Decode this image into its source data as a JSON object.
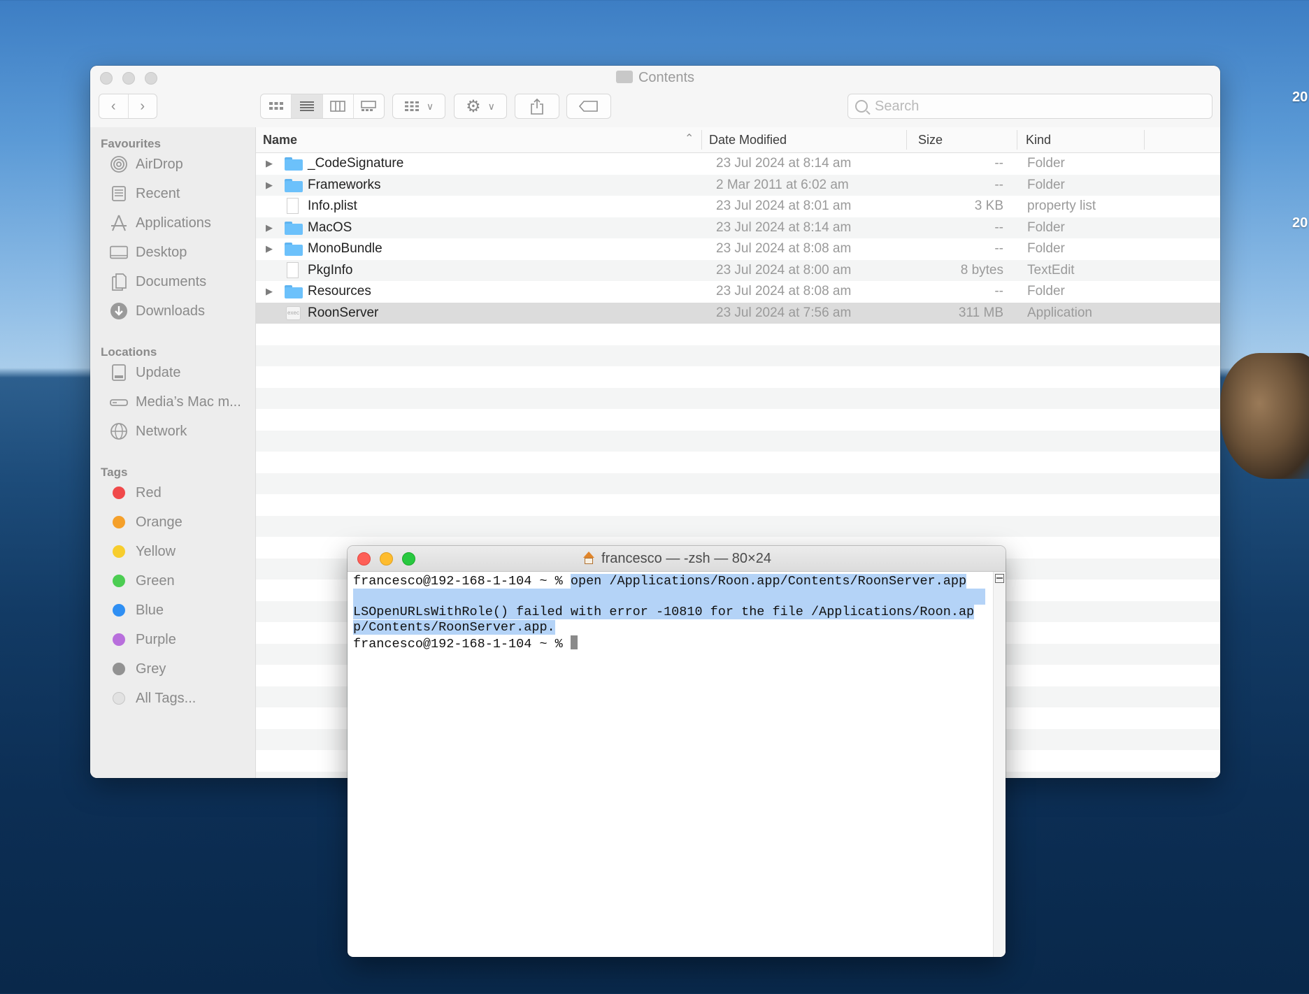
{
  "desktop": {
    "labels": [
      "20",
      "20"
    ]
  },
  "finder": {
    "title": "Contents",
    "search_placeholder": "Search",
    "sidebar": {
      "favourites_heading": "Favourites",
      "favourites": [
        {
          "label": "AirDrop",
          "icon": "airdrop-icon"
        },
        {
          "label": "Recent",
          "icon": "recent-icon"
        },
        {
          "label": "Applications",
          "icon": "applications-icon"
        },
        {
          "label": "Desktop",
          "icon": "desktop-icon"
        },
        {
          "label": "Documents",
          "icon": "documents-icon"
        },
        {
          "label": "Downloads",
          "icon": "downloads-icon"
        }
      ],
      "locations_heading": "Locations",
      "locations": [
        {
          "label": "Update",
          "icon": "disk-icon"
        },
        {
          "label": "Media’s Mac m...",
          "icon": "computer-icon"
        },
        {
          "label": "Network",
          "icon": "network-icon"
        }
      ],
      "tags_heading": "Tags",
      "tags": [
        {
          "label": "Red",
          "color": "#f0494a"
        },
        {
          "label": "Orange",
          "color": "#f5a02a"
        },
        {
          "label": "Yellow",
          "color": "#f7cd2d"
        },
        {
          "label": "Green",
          "color": "#4ccd52"
        },
        {
          "label": "Blue",
          "color": "#2f8ff3"
        },
        {
          "label": "Purple",
          "color": "#b86fdc"
        },
        {
          "label": "Grey",
          "color": "#929292"
        },
        {
          "label": "All Tags...",
          "color": "#e2e2e2"
        }
      ]
    },
    "columns": {
      "name": "Name",
      "date": "Date Modified",
      "size": "Size",
      "kind": "Kind"
    },
    "files": [
      {
        "name": "_CodeSignature",
        "date": "23 Jul 2024 at 8:14 am",
        "size": "--",
        "kind": "Folder",
        "type": "folder"
      },
      {
        "name": "Frameworks",
        "date": "2 Mar 2011 at 6:02 am",
        "size": "--",
        "kind": "Folder",
        "type": "folder"
      },
      {
        "name": "Info.plist",
        "date": "23 Jul 2024 at 8:01 am",
        "size": "3 KB",
        "kind": "property list",
        "type": "doc"
      },
      {
        "name": "MacOS",
        "date": "23 Jul 2024 at 8:14 am",
        "size": "--",
        "kind": "Folder",
        "type": "folder"
      },
      {
        "name": "MonoBundle",
        "date": "23 Jul 2024 at 8:08 am",
        "size": "--",
        "kind": "Folder",
        "type": "folder"
      },
      {
        "name": "PkgInfo",
        "date": "23 Jul 2024 at 8:00 am",
        "size": "8 bytes",
        "kind": "TextEdit",
        "type": "doc"
      },
      {
        "name": "Resources",
        "date": "23 Jul 2024 at 8:08 am",
        "size": "--",
        "kind": "Folder",
        "type": "folder"
      },
      {
        "name": "RoonServer",
        "date": "23 Jul 2024 at 7:56 am",
        "size": "311 MB",
        "kind": "Application",
        "type": "app"
      }
    ]
  },
  "terminal": {
    "title": "francesco — -zsh — 80×24",
    "prompt1": "francesco@192-168-1-104 ~ % ",
    "command": "open /Applications/Roon.app/Contents/RoonServer.app",
    "error_line1": "LSOpenURLsWithRole() failed with error -10810 for the file /Applications/Roon.ap",
    "error_line2": "p/Contents/RoonServer.app.",
    "prompt2": "francesco@192-168-1-104 ~ % "
  }
}
